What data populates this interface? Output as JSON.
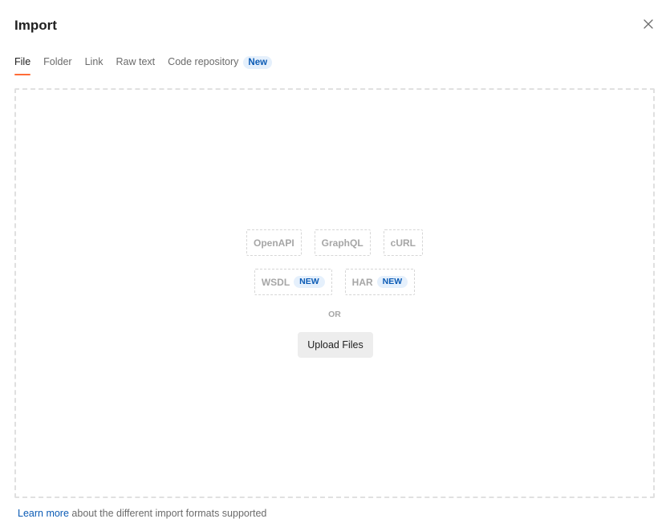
{
  "modal": {
    "title": "Import",
    "close_icon": "close-icon"
  },
  "tabs": [
    {
      "label": "File",
      "active": true
    },
    {
      "label": "Folder",
      "active": false
    },
    {
      "label": "Link",
      "active": false
    },
    {
      "label": "Raw text",
      "active": false
    },
    {
      "label": "Code repository",
      "active": false,
      "badge": "New"
    }
  ],
  "formats": {
    "row1": [
      {
        "label": "OpenAPI"
      },
      {
        "label": "GraphQL"
      },
      {
        "label": "cURL"
      }
    ],
    "row2": [
      {
        "label": "WSDL",
        "badge": "NEW"
      },
      {
        "label": "HAR",
        "badge": "NEW"
      }
    ]
  },
  "divider_text": "OR",
  "upload_button": "Upload Files",
  "footer": {
    "link_text": "Learn more",
    "text": "about the different import formats supported"
  },
  "colors": {
    "accent": "#ff6c37",
    "badge_text": "#0b5bb5",
    "badge_bg": "#e5f0fc"
  }
}
